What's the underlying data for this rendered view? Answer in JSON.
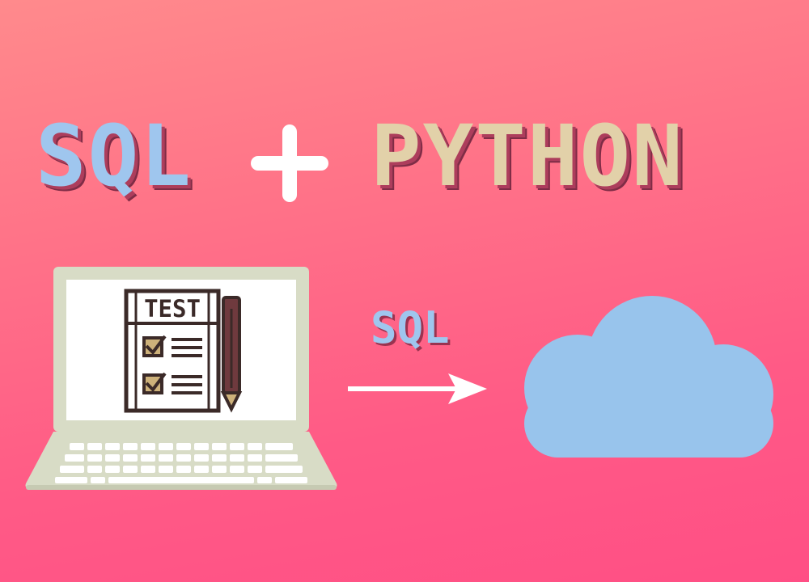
{
  "title": {
    "left_word": "SQL",
    "operator": "+",
    "right_word": "PYTHON"
  },
  "laptop": {
    "document_label": "TEST",
    "icons": [
      "laptop-icon",
      "test-checklist-icon",
      "pencil-icon"
    ]
  },
  "transfer": {
    "label": "SQL",
    "icons": [
      "right-arrow-icon",
      "cloud-icon"
    ]
  },
  "colors": {
    "background_top": "#ff8a8c",
    "background_bottom": "#ff4f85",
    "sql_blue": "#9fc6ee",
    "python_beige": "#e2d1a9",
    "laptop_body": "#d8dcc6",
    "cloud_blue": "#98c4ec"
  }
}
